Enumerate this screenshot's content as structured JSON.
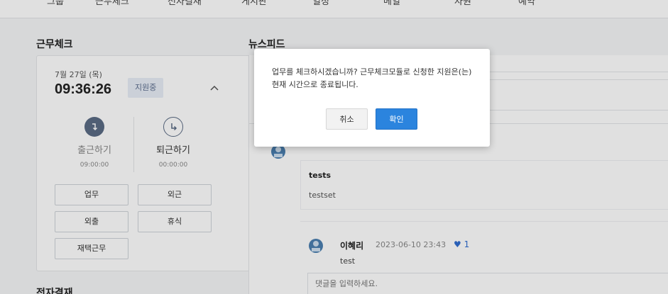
{
  "nav": [
    "그룹",
    "근무체크",
    "전자결재",
    "게시판",
    "일정",
    "메일",
    "자원",
    "예약"
  ],
  "work_check": {
    "section_title": "근무체크",
    "date": "7월 27일 (목)",
    "time": "09:36:26",
    "status": "지원중",
    "clock_in": {
      "label": "출근하기",
      "time": "09:00:00"
    },
    "clock_out": {
      "label": "퇴근하기",
      "time": "00:00:00"
    },
    "buttons": [
      "업무",
      "외근",
      "외출",
      "휴식",
      "재택근무"
    ]
  },
  "approval_title": "전자결재",
  "feed": {
    "section_title": "뉴스피드",
    "post": {
      "title": "tests",
      "body": "testset"
    },
    "comment": {
      "author": "이혜리",
      "date": "2023-06-10 23:43",
      "likes": "1",
      "text": "test",
      "input_placeholder": "댓글을 입력하세요."
    }
  },
  "modal": {
    "message": "업무를 체크하시겠습니까? 근무체크모듈로 신청한 지원은(는) 현재 시간으로 종료됩니다.",
    "cancel": "취소",
    "confirm": "확인"
  },
  "colors": {
    "accent": "#2b84de",
    "clock_in": "#5b6b84",
    "heart": "#2f6dd0"
  }
}
